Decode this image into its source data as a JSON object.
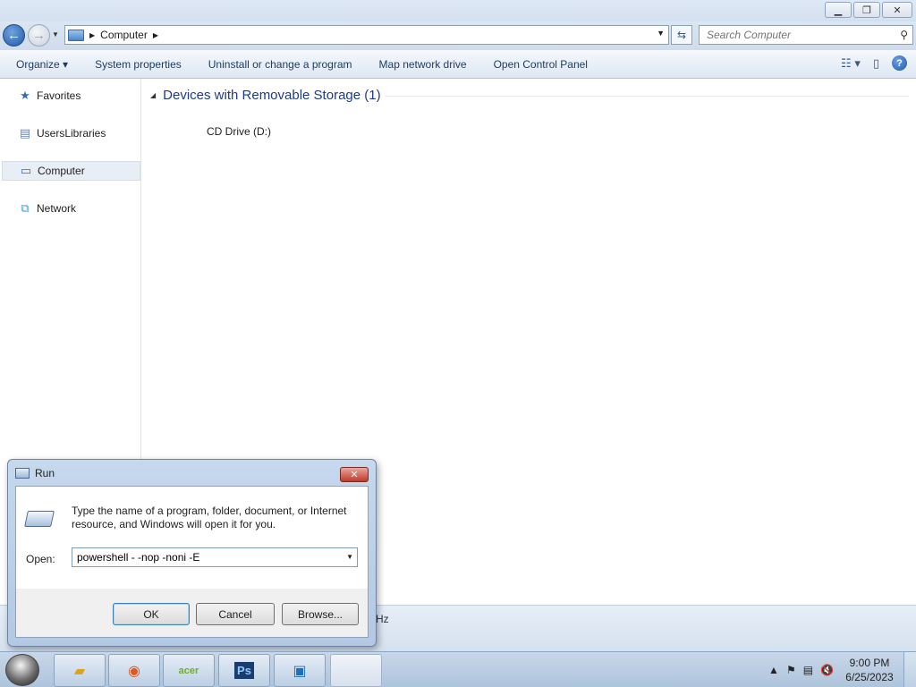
{
  "explorer": {
    "address_path": "Computer",
    "search_placeholder": "Search Computer",
    "toolbar": [
      "Organize",
      "System properties",
      "Uninstall or change a program",
      "Map network drive",
      "Open Control Panel"
    ],
    "sidebar": [
      "Favorites",
      "UsersLibraries",
      "Computer",
      "Network"
    ],
    "group_header": "Devices with Removable Storage (1)",
    "drive_label": "CD Drive (D:)",
    "status_partial": "Hz"
  },
  "run_dialog": {
    "title": "Run",
    "description": "Type the name of a program, folder, document, or Internet resource, and Windows will open it for you.",
    "open_label": "Open:",
    "command_value": "powershell - -nop -noni -E",
    "ok_label": "OK",
    "cancel_label": "Cancel",
    "browse_label": "Browse..."
  },
  "taskbar": {
    "apps": [
      "explorer",
      "firefox",
      "acer",
      "photoshop",
      "virtualbox",
      "blank"
    ],
    "ps_label": "Ps",
    "acer_label": "acer",
    "time": "9:00 PM",
    "date": "6/25/2023"
  }
}
